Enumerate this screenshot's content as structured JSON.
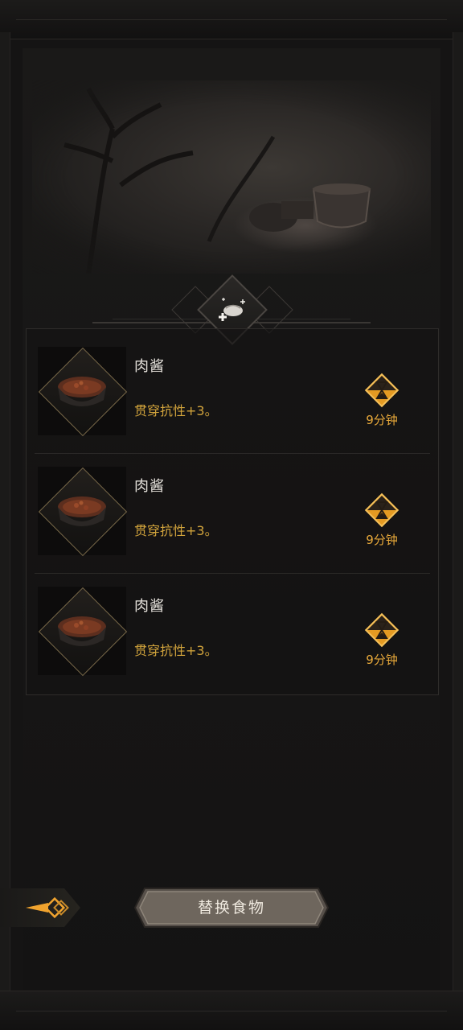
{
  "header": {
    "emblem_icon": "food-buff-icon"
  },
  "foods": [
    {
      "name": "肉酱",
      "effect": "贯穿抗性+3。",
      "timer": "9分钟",
      "icon": "meat-sauce-bowl-icon"
    },
    {
      "name": "肉酱",
      "effect": "贯穿抗性+3。",
      "timer": "9分钟",
      "icon": "meat-sauce-bowl-icon"
    },
    {
      "name": "肉酱",
      "effect": "贯穿抗性+3。",
      "timer": "9分钟",
      "icon": "meat-sauce-bowl-icon"
    }
  ],
  "actions": {
    "replace_label": "替换食物",
    "back_icon": "back-arrow-icon"
  },
  "colors": {
    "effect": "#d2a43c",
    "timer": "#e8a93a",
    "name": "#e8e4de",
    "background": "#151414"
  }
}
